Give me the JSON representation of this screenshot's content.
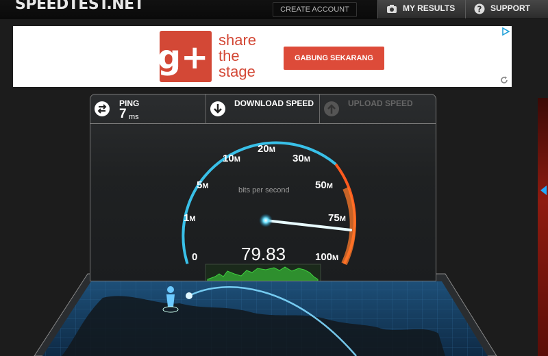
{
  "header": {
    "logo": "SPEEDTEST.NET",
    "create_account": "CREATE ACCOUNT",
    "nav": [
      {
        "label": "MY RESULTS",
        "icon": "camera-icon"
      },
      {
        "label": "SUPPORT",
        "icon": "help-icon"
      }
    ]
  },
  "ad": {
    "logo_text": "g+",
    "line1": "share",
    "line2": "the",
    "line3": "stage",
    "cta": "GABUNG SEKARANG",
    "choices_icon": "adchoices-icon",
    "refresh_icon": "refresh-icon"
  },
  "test": {
    "ping": {
      "label": "PING",
      "value": "7",
      "unit": "ms",
      "icon": "ping-icon"
    },
    "download": {
      "label": "DOWNLOAD SPEED",
      "icon": "download-arrow-icon",
      "state": "active"
    },
    "upload": {
      "label": "UPLOAD SPEED",
      "icon": "upload-arrow-icon",
      "state": "inactive"
    }
  },
  "gauge": {
    "unit_label": "bits per second",
    "readout": "79.83",
    "ticks": [
      {
        "num": "0",
        "suf": ""
      },
      {
        "num": "1",
        "suf": "M"
      },
      {
        "num": "5",
        "suf": "M"
      },
      {
        "num": "10",
        "suf": "M"
      },
      {
        "num": "20",
        "suf": "M"
      },
      {
        "num": "30",
        "suf": "M"
      },
      {
        "num": "50",
        "suf": "M"
      },
      {
        "num": "75",
        "suf": "M"
      },
      {
        "num": "100",
        "suf": "M"
      }
    ],
    "needle_value": 79.83,
    "colors": {
      "arc": "#39c0e8",
      "hot": "#ff5a1e",
      "needle": "#e8fbff",
      "graph": "#3ecf3e"
    }
  }
}
